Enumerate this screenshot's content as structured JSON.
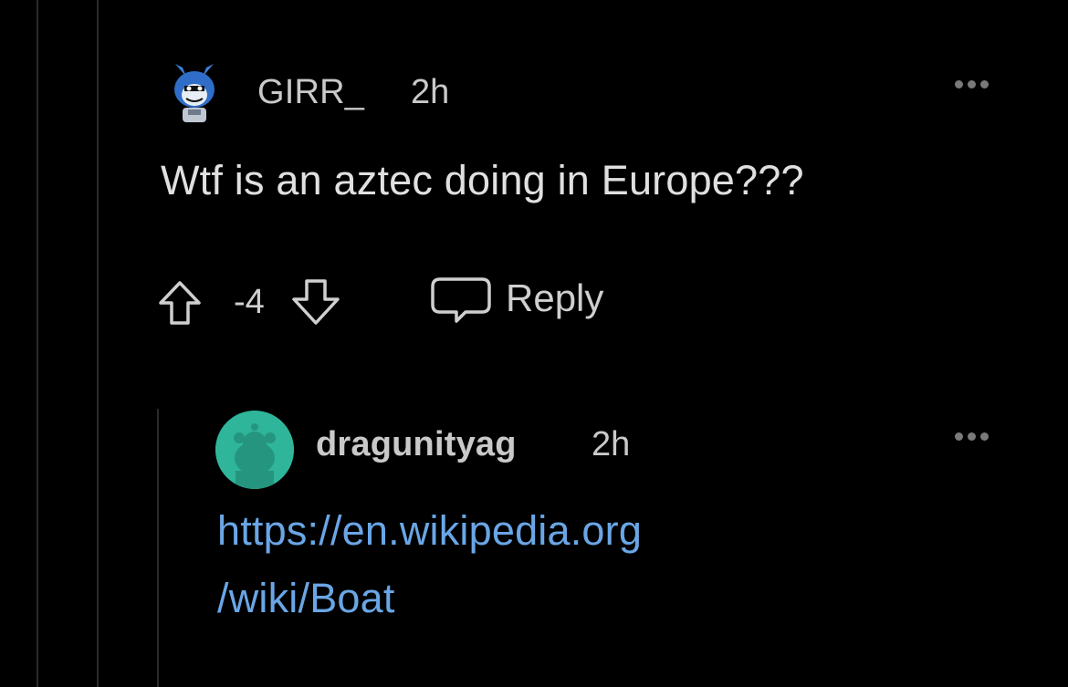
{
  "theme": {
    "background": "#000000",
    "text": "#e0e0e0",
    "muted": "#c9c9c9",
    "link": "#6aa6e6",
    "avatar_green": "#2fb59a"
  },
  "comment": {
    "username": "GIRR_",
    "time": "2h",
    "body": "Wtf is an aztec doing in Europe???",
    "avatar_icon": "blue-mascot-icon",
    "votes": "-4",
    "reply_label": "Reply",
    "more_icon": "ellipsis-icon"
  },
  "reply": {
    "username": "dragunityag",
    "time": "2h",
    "link_line1": "https://en.wikipedia.org",
    "link_line2": "/wiki/Boat",
    "avatar_icon": "snoo-avatar-icon",
    "more_icon": "ellipsis-icon"
  }
}
